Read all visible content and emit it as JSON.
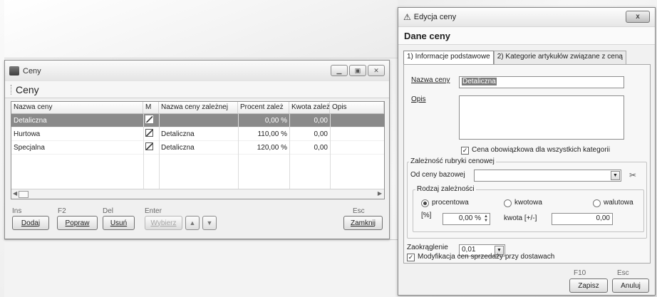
{
  "ceny_window": {
    "title": "Ceny",
    "header": "Ceny",
    "columns": [
      "Nazwa ceny",
      "M",
      "Nazwa ceny zależnej",
      "Procent zależ",
      "Kwota zależn",
      "Opis"
    ],
    "rows": [
      {
        "name": "Detaliczna",
        "dep": "",
        "percent": "0,00 %",
        "amount": "0,00",
        "opis": "",
        "selected": true
      },
      {
        "name": "Hurtowa",
        "dep": "Detaliczna",
        "percent": "110,00 %",
        "amount": "0,00",
        "opis": "",
        "selected": false
      },
      {
        "name": "Specjalna",
        "dep": "Detaliczna",
        "percent": "120,00 %",
        "amount": "0,00",
        "opis": "",
        "selected": false
      }
    ],
    "keys": {
      "ins": "Ins",
      "f2": "F2",
      "del": "Del",
      "enter": "Enter",
      "esc": "Esc"
    },
    "buttons": {
      "dodaj": "Dodaj",
      "popraw": "Popraw",
      "usun": "Usuń",
      "wybierz": "Wybierz",
      "zamknij": "Zamknij"
    }
  },
  "dialog": {
    "title": "Edycja ceny",
    "close": "x",
    "header": "Dane ceny",
    "tabs": [
      "1) Informacje podstawowe",
      "2) Kategorie artykułów związane z ceną"
    ],
    "nazwa_label": "Nazwa ceny",
    "nazwa_value": "Detaliczna",
    "opis_label": "Opis",
    "opis_value": "",
    "cena_obowiazkowa": "Cena obowiązkowa dla wszystkich kategorii",
    "zaleznosc_title": "Zależność rubryki cenowej",
    "od_ceny_label": "Od ceny bazowej",
    "od_ceny_value": "",
    "rodzaj_title": "Rodzaj zależności",
    "radio_procentowa": "procentowa",
    "radio_kwotowa": "kwotowa",
    "radio_walutowa": "walutowa",
    "percent_unit": "[%]",
    "percent_value": "0,00 %",
    "kwota_label": "kwota  [+/-]",
    "kwota_value": "0,00",
    "zaokraglenie_label": "Zaokrąglenie",
    "zaokraglenie_value": "0,01",
    "modyfikacja": "Modyfikacja cen sprzedaży przy dostawach",
    "keys": {
      "f10": "F10",
      "esc": "Esc"
    },
    "buttons": {
      "zapisz": "Zapisz",
      "anuluj": "Anuluj"
    }
  }
}
